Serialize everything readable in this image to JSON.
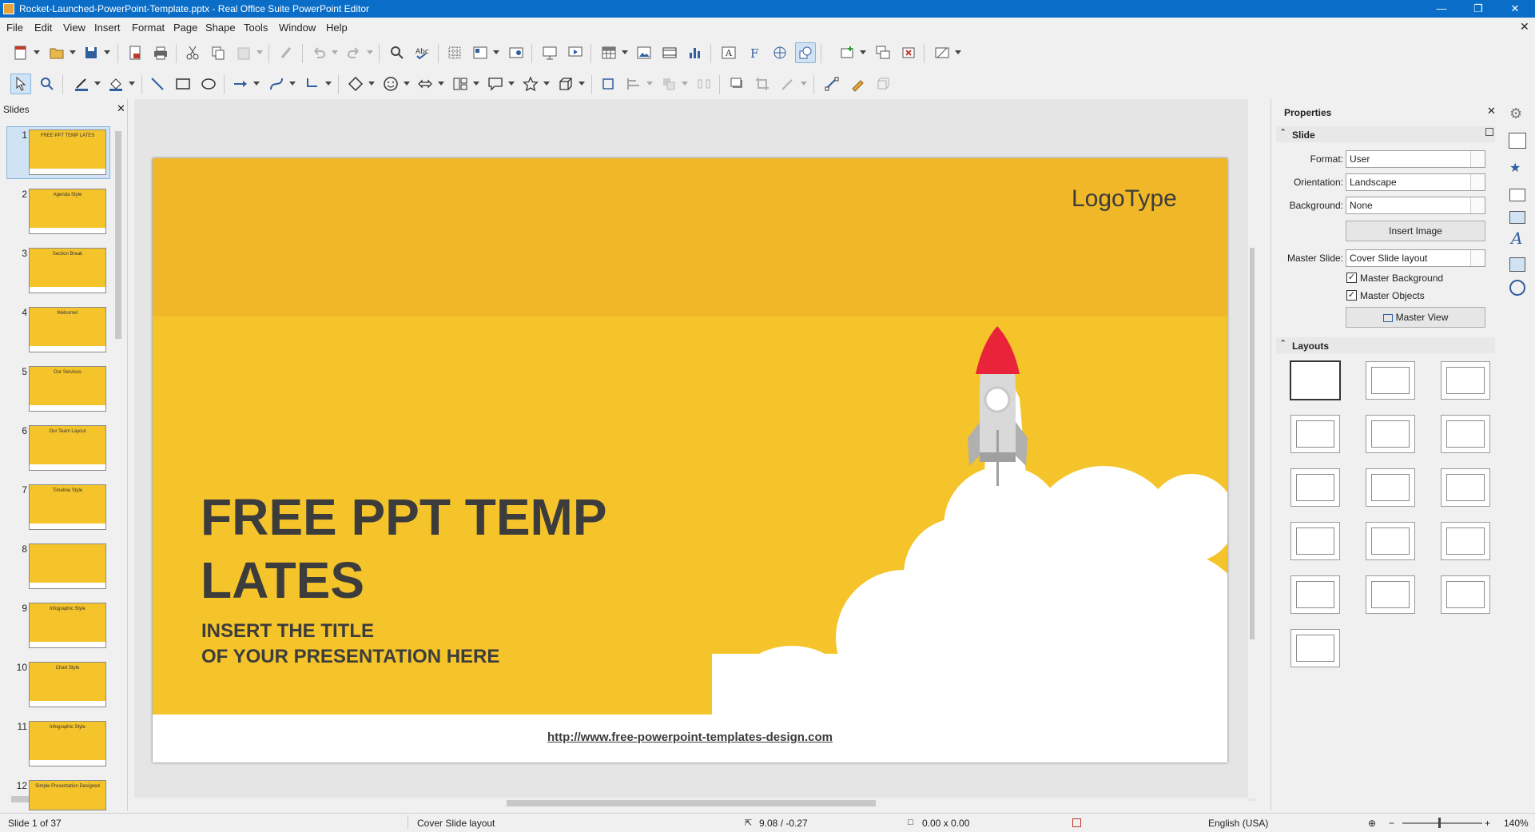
{
  "window": {
    "title": "Rocket-Launched-PowerPoint-Template.pptx - Real Office Suite PowerPoint Editor"
  },
  "menu": [
    "File",
    "Edit",
    "View",
    "Insert",
    "Format",
    "Page",
    "Shape",
    "Tools",
    "Window",
    "Help"
  ],
  "slides_pane": {
    "title": "Slides",
    "numbers": [
      "1",
      "2",
      "3",
      "4",
      "5",
      "6",
      "7",
      "8",
      "9",
      "10",
      "11",
      "12"
    ],
    "thumb_titles": [
      "FREE PPT TEMP LATES",
      "Agenda Style",
      "Section Break",
      "Welcome!",
      "Our Services",
      "Our Team Layout",
      "Timeline Style",
      "",
      "Infographic Style",
      "Chart Style",
      "Infographic Style",
      "Simple Presentation Designed"
    ]
  },
  "slide": {
    "logo": "LogoType",
    "title_line1": "FREE PPT TEMP",
    "title_line2": "LATES",
    "subtitle_line1": "INSERT THE TITLE",
    "subtitle_line2": "OF YOUR PRESENTATION HERE",
    "url": "http://www.free-powerpoint-templates-design.com"
  },
  "properties": {
    "title": "Properties",
    "slide_section": "Slide",
    "format_label": "Format:",
    "format_value": "User",
    "orientation_label": "Orientation:",
    "orientation_value": "Landscape",
    "background_label": "Background:",
    "background_value": "None",
    "insert_image": "Insert Image",
    "master_slide_label": "Master Slide:",
    "master_slide_value": "Cover Slide layout",
    "master_background": "Master Background",
    "master_objects": "Master Objects",
    "master_view": "Master View",
    "layouts_section": "Layouts"
  },
  "status": {
    "slide": "Slide 1 of 37",
    "layout": "Cover Slide layout",
    "position": "9.08 / -0.27",
    "size": "0.00 x 0.00",
    "language": "English (USA)",
    "zoom": "140%"
  },
  "colors": {
    "titlebar": "#0a6ec8",
    "slide_bg": "#f5c42a",
    "slide_top": "#f0b828",
    "rocket_tip": "#e8233a",
    "title_text": "#3c3c3c"
  }
}
